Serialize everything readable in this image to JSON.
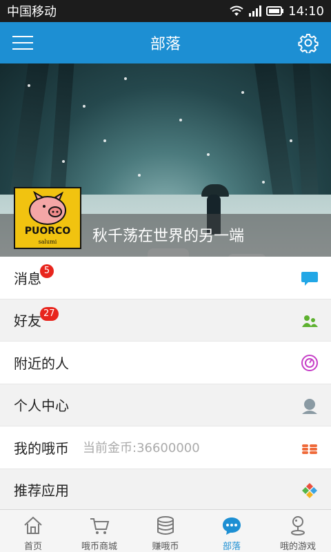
{
  "status_bar": {
    "carrier": "中国移动",
    "time": "14:10"
  },
  "header": {
    "title": "部落"
  },
  "profile": {
    "username": "秋千荡在世界的另一端",
    "avatar_text": "PUORCO",
    "avatar_subtext": "salumi"
  },
  "menu": {
    "items": [
      {
        "label": "消息",
        "badge": "5",
        "icon": "chat-bubble-icon"
      },
      {
        "label": "好友",
        "badge": "27",
        "icon": "friends-icon"
      },
      {
        "label": "附近的人",
        "icon": "nearby-icon"
      },
      {
        "label": "个人中心",
        "icon": "user-icon"
      },
      {
        "label": "我的哦币",
        "sub": "当前金币:36600000",
        "icon": "coins-icon"
      },
      {
        "label": "推荐应用",
        "icon": "apps-icon"
      }
    ]
  },
  "tabs": [
    {
      "label": "首页",
      "icon": "home-icon"
    },
    {
      "label": "哦币商城",
      "icon": "cart-icon"
    },
    {
      "label": "赚哦币",
      "icon": "coin-stack-icon"
    },
    {
      "label": "部落",
      "icon": "tribe-chat-icon",
      "active": true
    },
    {
      "label": "哦的游戏",
      "icon": "joystick-icon"
    }
  ],
  "colors": {
    "primary": "#1d8fd3",
    "badge": "#e8251d",
    "avatar_bg": "#f1c310"
  }
}
